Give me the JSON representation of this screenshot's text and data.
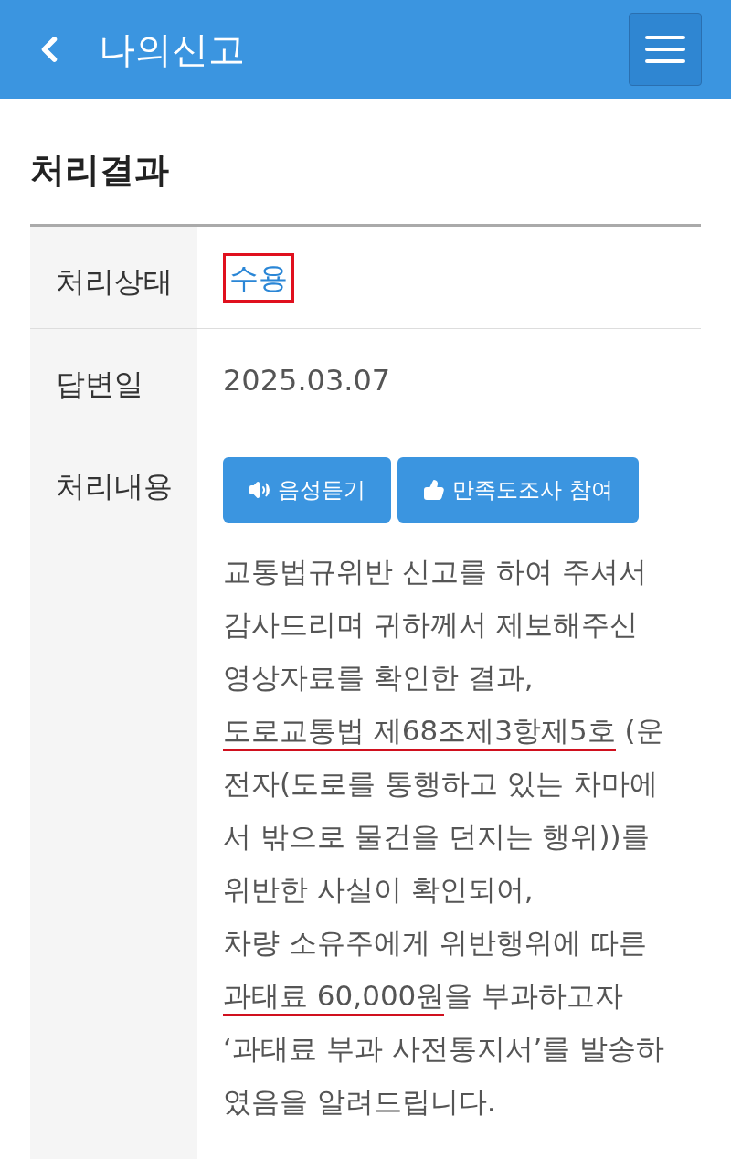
{
  "header": {
    "title": "나의신고"
  },
  "section_title": "처리결과",
  "rows": [
    {
      "kind": "status",
      "label": "처리상태",
      "value": "수용",
      "marked": true
    },
    {
      "kind": "date",
      "label": "답변일",
      "value": "2025.03.07"
    },
    {
      "kind": "content",
      "label": "처리내용",
      "buttons": [
        {
          "kind": "listen",
          "label": "음성듣기"
        },
        {
          "kind": "survey",
          "label": "만족도조사 참여"
        }
      ],
      "paragraphs": [
        [
          {
            "text": "교통법규위반 신고를 하여 주셔서 감사드리며 귀하께서 제보해주신 영상자료를 확인한 결과,",
            "underlined": false
          }
        ],
        [
          {
            "text": "도로교통법 제68조제3항제5호",
            "underlined": true
          },
          {
            "text": " (운전자(도로를 통행하고 있는 차마에서 밖으로 물건을 던지는 행위))를 위반한 사실이 확인되어,",
            "underlined": false
          }
        ],
        [
          {
            "text": "차량 소유주에게 위반행위에 따른 ",
            "underlined": false
          },
          {
            "text": "과태료 60,000원",
            "underlined": true
          },
          {
            "text": "을 부과하고자 ‘과태료 부과 사전통지서’를 발송하였음을 알려드립니다.",
            "underlined": false
          }
        ]
      ]
    }
  ]
}
